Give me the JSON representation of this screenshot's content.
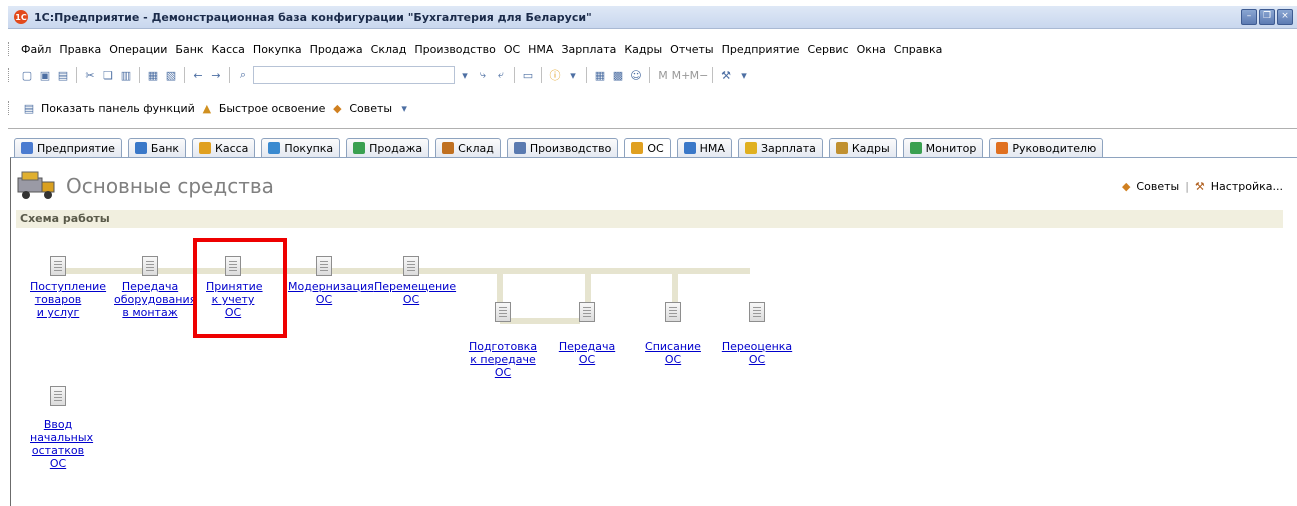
{
  "window": {
    "title": "1С:Предприятие - Демонстрационная база конфигурации \"Бухгалтерия для Беларуси\""
  },
  "menu": [
    "Файл",
    "Правка",
    "Операции",
    "Банк",
    "Касса",
    "Покупка",
    "Продажа",
    "Склад",
    "Производство",
    "ОС",
    "НМА",
    "Зарплата",
    "Кадры",
    "Отчеты",
    "Предприятие",
    "Сервис",
    "Окна",
    "Справка"
  ],
  "toolbar2": {
    "show_panel": "Показать панель функций",
    "quick_start": "Быстрое освоение",
    "tips": "Советы"
  },
  "tabs": [
    {
      "label": "Предприятие",
      "color": "#4a7bd0"
    },
    {
      "label": "Банк",
      "color": "#3a78c8"
    },
    {
      "label": "Касса",
      "color": "#e0a020"
    },
    {
      "label": "Покупка",
      "color": "#3a8ad0"
    },
    {
      "label": "Продажа",
      "color": "#3aa050"
    },
    {
      "label": "Склад",
      "color": "#c07020"
    },
    {
      "label": "Производство",
      "color": "#5a7ab0"
    },
    {
      "label": "ОС",
      "color": "#e0a020",
      "active": true
    },
    {
      "label": "НМА",
      "color": "#3a78c8"
    },
    {
      "label": "Зарплата",
      "color": "#e0b020"
    },
    {
      "label": "Кадры",
      "color": "#c09030"
    },
    {
      "label": "Монитор",
      "color": "#3aa050"
    },
    {
      "label": "Руководителю",
      "color": "#e07020"
    }
  ],
  "section": {
    "title": "Основные средства",
    "scheme_label": "Схема работы",
    "tips": "Советы",
    "settings": "Настройка..."
  },
  "nodes": {
    "n1": "Поступление товаров и услуг",
    "n2": "Передача оборудования в монтаж",
    "n3": "Принятие к учету ОС",
    "n4": "Модернизация ОС",
    "n5": "Перемещение ОС",
    "n6": "Подготовка к передаче ОС",
    "n7": "Передача ОС",
    "n8": "Списание ОС",
    "n9": "Переоценка ОС",
    "n10": "Ввод начальных остатков ОС"
  },
  "colors": {
    "link": "#0000cc",
    "highlight": "#ee0000",
    "scheme_bg": "#f1efdf"
  }
}
